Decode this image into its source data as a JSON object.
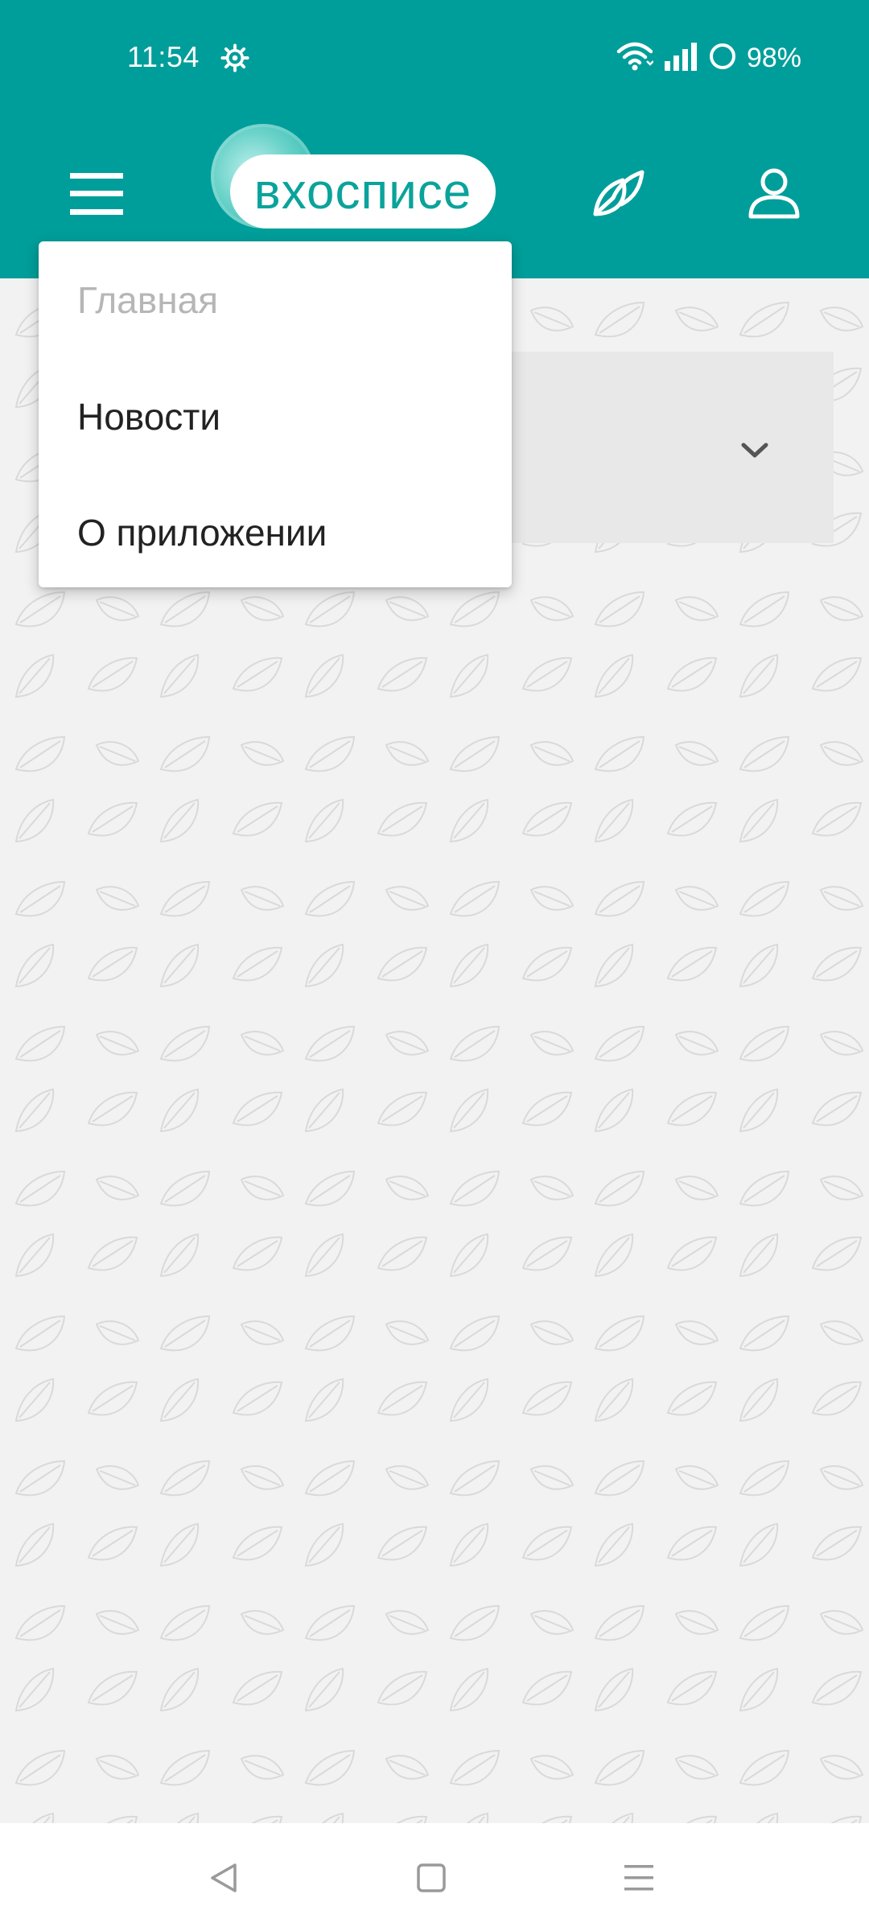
{
  "status_bar": {
    "time": "11:54",
    "battery_percent": "98%",
    "icons": [
      "gear-icon",
      "wifi-icon",
      "signal-icon",
      "battery-icon"
    ]
  },
  "app_bar": {
    "logo_text": "вхосписе",
    "icons": [
      "menu-icon",
      "leaf-icon",
      "user-icon"
    ],
    "accent_color": "#009e9a"
  },
  "dropdown": {
    "items": [
      {
        "label": "Главная",
        "enabled": false
      },
      {
        "label": "Новости",
        "enabled": true
      },
      {
        "label": "О приложении",
        "enabled": true
      }
    ]
  },
  "select": {
    "icon": "chevron-down-icon"
  },
  "nav_bar": {
    "icons": [
      "back-icon",
      "home-icon",
      "recents-icon"
    ]
  }
}
